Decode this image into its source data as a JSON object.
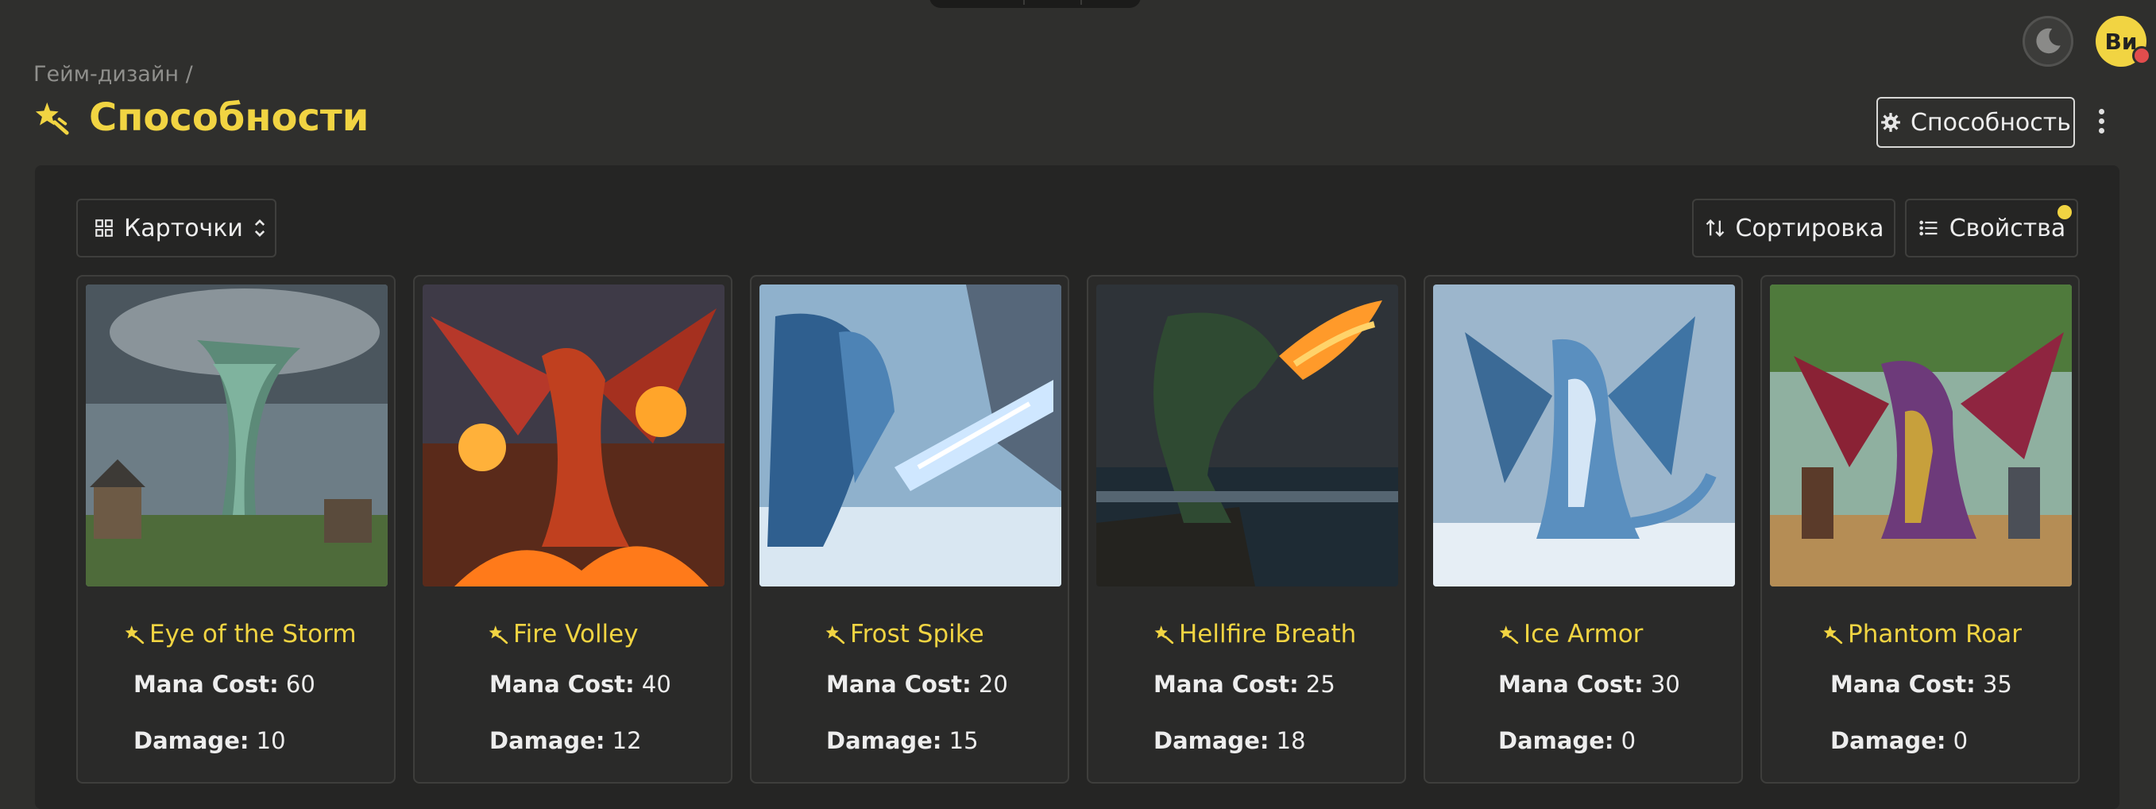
{
  "breadcrumb": "Гейм-дизайн /",
  "page": {
    "title": "Способности"
  },
  "header": {
    "avatar_initials": "Ви",
    "ability_button_label": "Способность"
  },
  "toolbar": {
    "view_label": "Карточки",
    "sort_label": "Сортировка",
    "properties_label": "Свойства"
  },
  "labels": {
    "mana_cost": "Mana Cost:",
    "damage": "Damage:"
  },
  "colors": {
    "accent": "#f1d442",
    "background": "#2f2f2d",
    "panel": "#252524"
  },
  "cards": [
    {
      "title": "Eye of the Storm",
      "mana_cost": "60",
      "damage": "10",
      "image": "storm-tornado"
    },
    {
      "title": "Fire Volley",
      "mana_cost": "40",
      "damage": "12",
      "image": "red-fire-dragon"
    },
    {
      "title": "Frost Spike",
      "mana_cost": "20",
      "damage": "15",
      "image": "blue-ice-dragon"
    },
    {
      "title": "Hellfire Breath",
      "mana_cost": "25",
      "damage": "18",
      "image": "green-fire-breathing-beast"
    },
    {
      "title": "Ice Armor",
      "mana_cost": "30",
      "damage": "0",
      "image": "frost-dragon"
    },
    {
      "title": "Phantom Roar",
      "mana_cost": "35",
      "damage": "0",
      "image": "purple-dragon-warriors"
    }
  ]
}
